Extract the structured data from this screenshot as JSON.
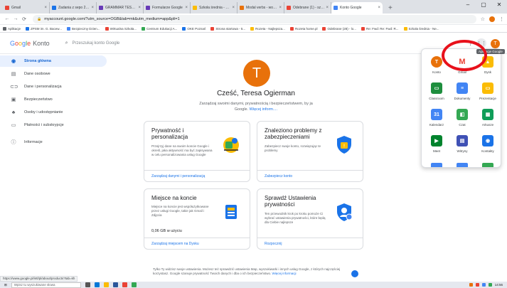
{
  "browser": {
    "tabs": [
      {
        "title": "Gmail",
        "color": "#ea4335"
      },
      {
        "title": "Zadania z sepo 2020/2021",
        "color": "#1a73e8"
      },
      {
        "title": "GRAMMAR TEST - UNIT 6",
        "color": "#673ab7"
      },
      {
        "title": "Formularze Google",
        "color": "#673ab7"
      },
      {
        "title": "Szkoła średnia - Nowe Emo",
        "color": "#fbbc05"
      },
      {
        "title": "Modal verbs - worksheets",
        "color": "#e8710a"
      },
      {
        "title": "Odebrane (1) - szkoła@zs",
        "color": "#ea4335"
      },
      {
        "title": "Konto Google",
        "color": "#4285f4",
        "active": true
      }
    ],
    "newtab": "+",
    "winctl": [
      "–",
      "▢",
      "✕"
    ],
    "url": "myaccount.google.com/?utm_source=OGB&tab=mk&utm_medium=app&pli=1",
    "bookmarks": [
      {
        "label": "Aplikacje",
        "color": "#5f6368"
      },
      {
        "label": "ZPSM im. G. Bacew...",
        "color": "#1a73e8"
      },
      {
        "label": "Bezpieczny Dzien...",
        "color": "#4285f4"
      },
      {
        "label": "Wirtualna Szkoła...",
        "color": "#ea4335"
      },
      {
        "label": "Centrum Edukacji A...",
        "color": "#34a853"
      },
      {
        "label": "OKE Poznań",
        "color": "#1a73e8"
      },
      {
        "label": "Strona startowa - 5...",
        "color": "#ea4335"
      },
      {
        "label": "Rozeta - Najlepsza...",
        "color": "#fbbc05"
      },
      {
        "label": "Rozeta home.pl",
        "color": "#ea4335"
      },
      {
        "label": "Odebrane (28) - lo...",
        "color": "#ea4335"
      },
      {
        "label": "Re: Fwd: Re: Fwd: R...",
        "color": "#ea4335"
      },
      {
        "label": "Szkoła średnia - Ne...",
        "color": "#fbbc05"
      }
    ]
  },
  "header": {
    "logo_letters": [
      "G",
      "o",
      "o",
      "g",
      "l",
      "e"
    ],
    "logo_suffix": "Konto",
    "search_placeholder": "Przeszukaj konto Google",
    "help_icon": "?",
    "grid_icon": "⋮⋮",
    "avatar_letter": "T"
  },
  "sidebar": {
    "items": [
      {
        "label": "Strona główna",
        "icon": "home-icon",
        "glyph": "◉",
        "active": true
      },
      {
        "label": "Dane osobowe",
        "icon": "id-card-icon",
        "glyph": "▤"
      },
      {
        "label": "Dane i personalizacja",
        "icon": "toggle-icon",
        "glyph": "⊂⊃"
      },
      {
        "label": "Bezpieczeństwo",
        "icon": "lock-icon",
        "glyph": "▣"
      },
      {
        "label": "Osoby i udostępnianie",
        "icon": "people-icon",
        "glyph": "♣"
      },
      {
        "label": "Płatności i subskrypcje",
        "icon": "card-icon",
        "glyph": "▭"
      },
      {
        "label": "Informacje",
        "icon": "info-icon",
        "glyph": "ⓘ"
      }
    ]
  },
  "main": {
    "avatar_letter": "T",
    "greeting": "Cześć, Teresa Ogierman",
    "subtitle": "Zarządzaj swoimi danymi, prywatnością i bezpieczeństwem, by ja",
    "subtitle2": "Google.",
    "more_link": "Więcej inform....",
    "cards": [
      {
        "title": "Prywatność i personalizacja",
        "desc": "Przejrzyj dane na swoim koncie Google i określ, jaka aktywność ma być zapisywana w celu personalizowania usług Google",
        "link": "Zarządzaj danymi i personalizacją"
      },
      {
        "title": "Znaleziono problemy z zabezpieczeniami",
        "desc": "Zabezpiecz swoje konto, rozwiązując te problemy",
        "link": "Zabezpiecz konto"
      },
      {
        "title": "Miejsce na koncie",
        "desc": "Miejsce na koncie jest współużytkowane przez usługi Google, takie jak Gmail i Zdjęcia",
        "value": "0,06 GB w użyciu",
        "link": "Zarządzaj miejscem na Dysku"
      },
      {
        "title": "Sprawdź Ustawienia prywatności",
        "desc": "Ten przewodnik krok po kroku pomoże Ci wybrać ustawienia prywatności, które będą dla Ciebie najlepsze",
        "link": "Rozpocznij"
      }
    ],
    "footer": "Tylko Ty widzisz swoje ustawienia. Możesz też sprawdzić ustawienia Map, wyszukiwarki i innych usług Google, z których najczęściej korzystasz. Google szanuje prywatność Twoich danych i dba o ich bezpieczeństwo.",
    "footer_link": "Więcej informacji"
  },
  "apps_panel": {
    "tooltip": "Aplikacje Google",
    "apps": [
      {
        "label": "Konto",
        "color": "#e8710a",
        "glyph": "T"
      },
      {
        "label": "Gmail",
        "color": "#ffffff",
        "glyph": "M"
      },
      {
        "label": "Dysk",
        "color": "#fbbc05",
        "glyph": "▲"
      },
      {
        "label": "Classroom",
        "color": "#1e8e3e",
        "glyph": "▭"
      },
      {
        "label": "Dokumenty",
        "color": "#4285f4",
        "glyph": "≡"
      },
      {
        "label": "Prezentacje",
        "color": "#fbbc05",
        "glyph": "▭"
      },
      {
        "label": "Kalendarz",
        "color": "#4285f4",
        "glyph": "31"
      },
      {
        "label": "Czat",
        "color": "#34a853",
        "glyph": "◧"
      },
      {
        "label": "Arkusze",
        "color": "#0f9d58",
        "glyph": "▦"
      },
      {
        "label": "Meet",
        "color": "#00832d",
        "glyph": "▶"
      },
      {
        "label": "Witryny",
        "color": "#3f51b5",
        "glyph": "▤"
      },
      {
        "label": "Kontakty",
        "color": "#1a73e8",
        "glyph": "◉"
      }
    ]
  },
  "status_url": "https://www.google.pl/intl/pl/about/products?tab=kh",
  "taskbar": {
    "start": "⊞",
    "search_placeholder": "Wpisz tu wyszukiwane słowa",
    "clock": "14:56"
  }
}
